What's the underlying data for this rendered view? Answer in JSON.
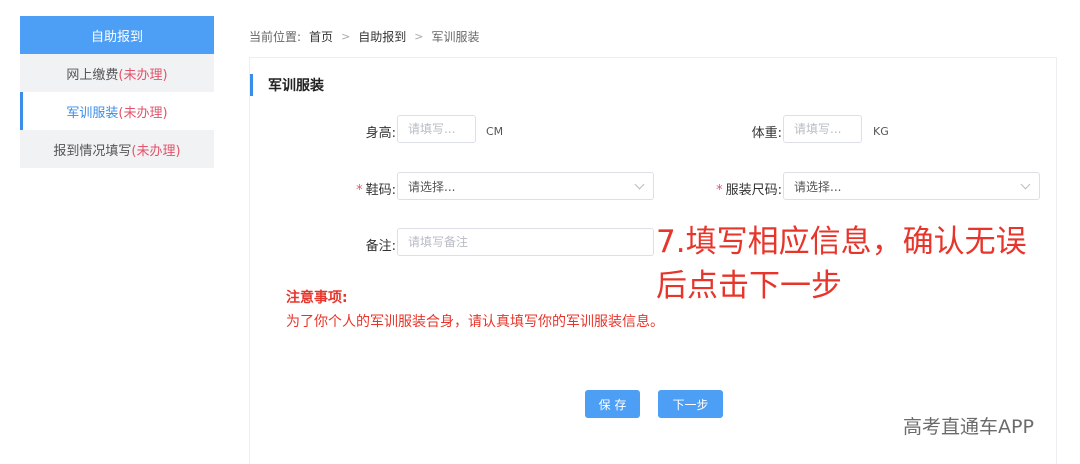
{
  "sidebar": {
    "header": "自助报到",
    "items": [
      {
        "label": "网上缴费",
        "status": "(未办理)"
      },
      {
        "label": "军训服装",
        "status": "(未办理)"
      },
      {
        "label": "报到情况填写",
        "status": "(未办理)"
      }
    ]
  },
  "breadcrumb": {
    "prefix": "当前位置:",
    "home": "首页",
    "section": "自助报到",
    "current": "军训服装",
    "separator": ">"
  },
  "panel": {
    "title": "军训服装"
  },
  "form": {
    "height": {
      "label": "身高:",
      "placeholder": "请填写...",
      "unit": "CM"
    },
    "weight": {
      "label": "体重:",
      "placeholder": "请填写...",
      "unit": "KG"
    },
    "shoe_size": {
      "required_mark": "*",
      "label": "鞋码:",
      "value": "请选择..."
    },
    "clothing_size": {
      "required_mark": "*",
      "label": "服装尺码:",
      "value": "请选择..."
    },
    "remark": {
      "label": "备注:",
      "placeholder": "请填写备注"
    }
  },
  "notice": {
    "title": "注意事项:",
    "text": "为了你个人的军训服装合身，请认真填写你的军训服装信息。"
  },
  "buttons": {
    "save": "保 存",
    "next": "下一步"
  },
  "annotation": {
    "line1": "7.填写相应信息，确认无误",
    "line2": "后点击下一步"
  },
  "watermark": "高考直通车APP",
  "colors": {
    "accent": "#4d9ef5",
    "warning": "#e8352b",
    "status": "#e2536a"
  }
}
